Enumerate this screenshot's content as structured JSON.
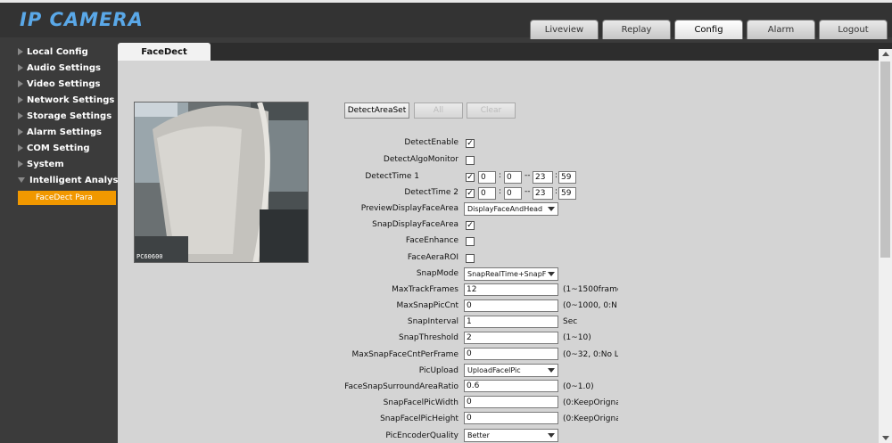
{
  "app": {
    "logo": "IP CAMERA"
  },
  "nav": {
    "tabs": [
      "Liveview",
      "Replay",
      "Config",
      "Alarm",
      "Logout"
    ],
    "active": "Config"
  },
  "sidebar": {
    "items": [
      "Local Config",
      "Audio Settings",
      "Video Settings",
      "Network Settings",
      "Storage Settings",
      "Alarm Settings",
      "COM Setting",
      "System",
      "Intelligent Analysis"
    ],
    "subitem": "FaceDect Para"
  },
  "page": {
    "tab": "FaceDect"
  },
  "preview": {
    "label": "PC60600"
  },
  "buttons": {
    "detect_area_set": "DetectAreaSet",
    "all": "All",
    "clear": "Clear"
  },
  "form": {
    "detect_enable": {
      "label": "DetectEnable",
      "checked": true
    },
    "detect_algo_monitor": {
      "label": "DetectAlgoMonitor",
      "checked": false
    },
    "detect_time_1": {
      "label": "DetectTime 1",
      "checked": true,
      "start_h": "0",
      "start_m": "0",
      "end_h": "23",
      "end_m": "59"
    },
    "detect_time_2": {
      "label": "DetectTime 2",
      "checked": true,
      "start_h": "0",
      "start_m": "0",
      "end_h": "23",
      "end_m": "59"
    },
    "time_colon": ":",
    "time_dash": "--",
    "preview_display_face_area": {
      "label": "PreviewDisplayFaceArea",
      "value": "DisplayFaceAndHead"
    },
    "snap_display_face_area": {
      "label": "SnapDisplayFaceArea",
      "checked": true
    },
    "face_enhance": {
      "label": "FaceEnhance",
      "checked": false
    },
    "face_aera_roi": {
      "label": "FaceAeraROI",
      "checked": false
    },
    "snap_mode": {
      "label": "SnapMode",
      "value": "SnapRealTime+SnapF"
    },
    "max_track_frames": {
      "label": "MaxTrackFrames",
      "value": "12",
      "hint": "(1~1500frame"
    },
    "max_snap_pic_cnt": {
      "label": "MaxSnapPicCnt",
      "value": "0",
      "hint": "(0~1000, 0:N"
    },
    "snap_interval": {
      "label": "SnapInterval",
      "value": "1",
      "hint": "Sec"
    },
    "snap_threshold": {
      "label": "SnapThreshold",
      "value": "2",
      "hint": "(1~10)"
    },
    "max_snap_face_cnt_per_frame": {
      "label": "MaxSnapFaceCntPerFrame",
      "value": "0",
      "hint": "(0~32, 0:No L"
    },
    "pic_upload": {
      "label": "PicUpload",
      "value": "UploadFacelPic"
    },
    "face_snap_surround_area_ratio": {
      "label": "FaceSnapSurroundAreaRatio",
      "value": "0.6",
      "hint": "(0~1.0)"
    },
    "snap_facel_pic_width": {
      "label": "SnapFacelPicWidth",
      "value": "0",
      "hint": "(0:KeepOrigna"
    },
    "snap_facel_pic_height": {
      "label": "SnapFacelPicHeight",
      "value": "0",
      "hint": "(0:KeepOrigna"
    },
    "pic_encoder_quality": {
      "label": "PicEncoderQuality",
      "value": "Better"
    }
  }
}
